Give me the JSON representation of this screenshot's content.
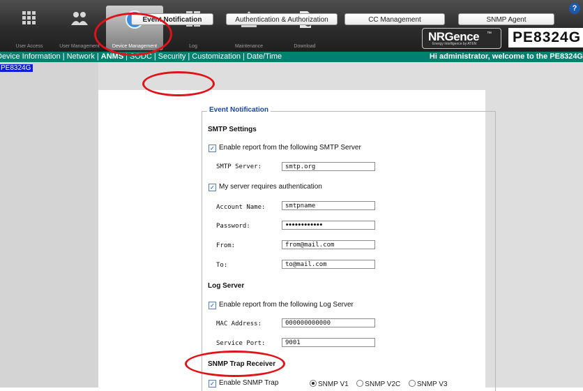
{
  "topbar": {
    "nav": [
      {
        "label": "User Access",
        "icon": "user-access-grid-icon"
      },
      {
        "label": "User Management",
        "icon": "users-icon"
      },
      {
        "label": "Device Management",
        "icon": "device-management-icon",
        "active": true
      },
      {
        "label": "Log",
        "icon": "log-icon"
      },
      {
        "label": "Maintenance",
        "icon": "maintenance-icon"
      },
      {
        "label": "Download",
        "icon": "download-icon"
      }
    ],
    "help_icon": "?",
    "brand_name": "NRGence",
    "brand_tm": "™",
    "brand_tagline": "Energy Intelligence by ATEN",
    "model": "PE8324G"
  },
  "menubar": {
    "items": [
      "Device Information",
      "Network",
      "ANMS",
      "SODC",
      "Security",
      "Customization",
      "Date/Time"
    ],
    "welcome": "Hi administrator, welcome to the PE8324G"
  },
  "sidebar": {
    "device": "PE8324G"
  },
  "tabs": [
    {
      "label": "Event Notification",
      "active": true
    },
    {
      "label": "Authentication & Authorization"
    },
    {
      "label": "CC Management"
    },
    {
      "label": "SNMP Agent"
    }
  ],
  "form": {
    "legend": "Event Notification",
    "smtp": {
      "title": "SMTP Settings",
      "enable_label": "Enable report from the following SMTP Server",
      "enable_checked": true,
      "server_label": "SMTP Server:",
      "server_value": "smtp.org",
      "auth_label": "My server requires authentication",
      "auth_checked": true,
      "account_label": "Account Name:",
      "account_value": "smtpname",
      "password_label": "Password:",
      "password_value": "••••••••••••",
      "from_label": "From:",
      "from_value": "from@mail.com",
      "to_label": "To:",
      "to_value": "to@mail.com"
    },
    "log": {
      "title": "Log Server",
      "enable_label": "Enable report from the following Log Server",
      "enable_checked": true,
      "mac_label": "MAC Address:",
      "mac_value": "000000000000",
      "port_label": "Service Port:",
      "port_value": "9001"
    },
    "snmp": {
      "title": "SNMP Trap Receiver",
      "enable_label": "Enable SNMP Trap",
      "enable_checked": true,
      "versions": [
        "SNMP V1",
        "SNMP V2C",
        "SNMP V3"
      ],
      "selected": "SNMP V1"
    }
  },
  "colors": {
    "menubar": "#00816f",
    "legend": "#1846a6",
    "annotation": "#e0121a",
    "device_link": "#0a1fd6"
  }
}
